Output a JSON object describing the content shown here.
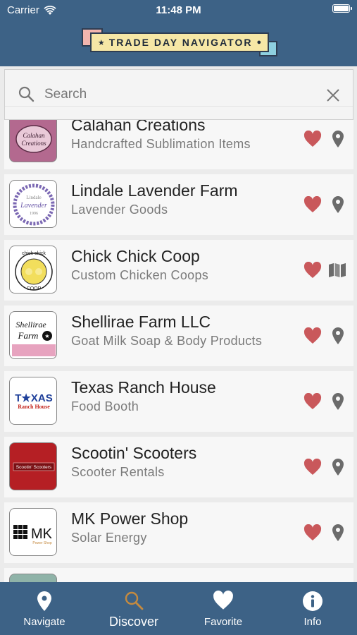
{
  "status_bar": {
    "carrier": "Carrier",
    "time": "11:48 PM"
  },
  "header": {
    "logo_text": "TRADE DAY NAVIGATOR"
  },
  "search": {
    "placeholder": "Search",
    "value": ""
  },
  "colors": {
    "header_bg": "#3d6286",
    "heart": "#c9585b",
    "icon_gray": "#6b6b6b",
    "discover_active": "#c58a3f"
  },
  "listings": [
    {
      "title": "Calahan Creations",
      "subtitle": "Handcrafted Sublimation Items",
      "logo_text": "Calahan Creations",
      "location_icon": "map-pin-icon"
    },
    {
      "title": "Lindale Lavender Farm",
      "subtitle": "Lavender Goods",
      "logo_text": "Lindale Lavender 1996",
      "location_icon": "map-pin-icon"
    },
    {
      "title": "Chick Chick Coop",
      "subtitle": "Custom Chicken Coops",
      "logo_text": "chick chick COOP",
      "location_icon": "map-icon"
    },
    {
      "title": "Shellirae Farm LLC",
      "subtitle": "Goat Milk Soap & Body Products",
      "logo_text": "Shellirae Farm",
      "location_icon": "map-pin-icon"
    },
    {
      "title": "Texas Ranch House",
      "subtitle": "Food Booth",
      "logo_text": "TEXAS Ranch House",
      "location_icon": "map-pin-icon"
    },
    {
      "title": "Scootin' Scooters",
      "subtitle": "Scooter Rentals",
      "logo_text": "Scootin' Scooters",
      "location_icon": "map-pin-icon"
    },
    {
      "title": "MK Power Shop",
      "subtitle": "Solar Energy",
      "logo_text": "MK Power Shop",
      "location_icon": "map-pin-icon"
    }
  ],
  "tabs": [
    {
      "label": "Navigate",
      "icon": "map-pin-icon"
    },
    {
      "label": "Discover",
      "icon": "search-icon",
      "active": true
    },
    {
      "label": "Favorite",
      "icon": "heart-icon"
    },
    {
      "label": "Info",
      "icon": "info-icon"
    }
  ]
}
